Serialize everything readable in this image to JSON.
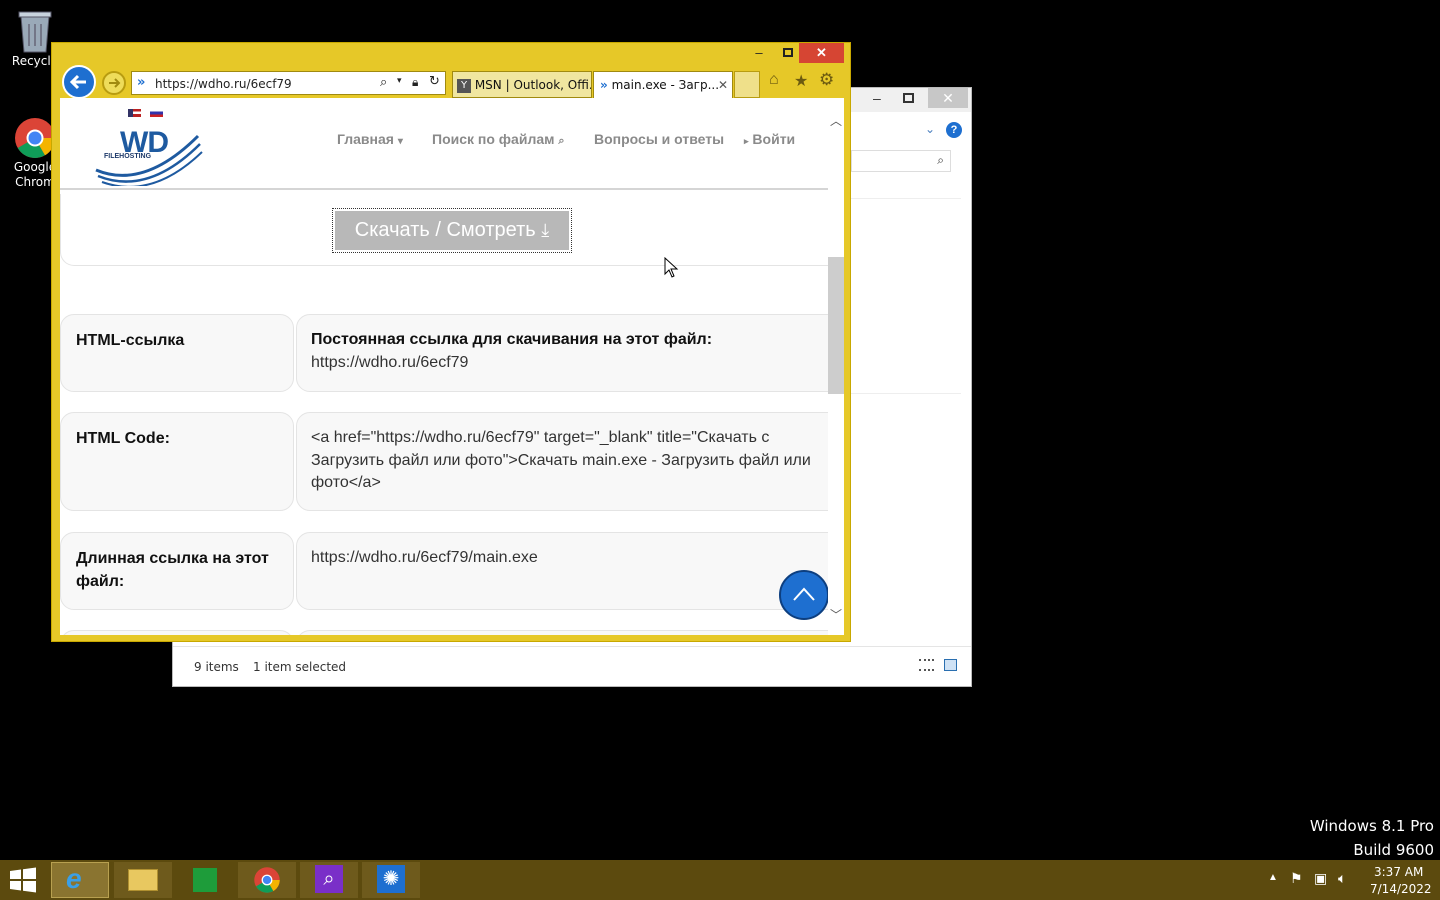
{
  "desktop": {
    "recycle_label": "Recycle",
    "chrome_label_1": "Google",
    "chrome_label_2": "Chrom",
    "watermark_1": "Windows 8.1 Pro",
    "watermark_2": "Build 9600"
  },
  "explorer": {
    "items_count": "9 items",
    "selection": "1 item selected"
  },
  "browser": {
    "address": "https://wdho.ru/6ecf79",
    "tabs": [
      {
        "label": "MSN | Outlook, Offi..."
      },
      {
        "label": "main.exe - Загр..."
      }
    ]
  },
  "site": {
    "logo_text": "WD",
    "logo_sub": "FILEHOSTING",
    "nav": {
      "home": "Главная",
      "search": "Поиск по файлам",
      "faq": "Вопросы и ответы",
      "login": "Войти"
    },
    "download_button": "Скачать / Смотреть",
    "rows": [
      {
        "label": "HTML-ссылка",
        "value_bold": "Постоянная ссылка для скачивания на этот файл:",
        "value": "https://wdho.ru/6ecf79"
      },
      {
        "label": "HTML Code:",
        "value_line1": "<a href=\"https://wdho.ru/6ecf79\" target=\"_blank\" title=\"Скачать с",
        "value_line2": "Загрузить файл или фото\">Скачать main.exe - Загрузить файл или",
        "value_line3": "фото</a>"
      },
      {
        "label_line1": "Длинная ссылка на этот",
        "label_line2": "файл:",
        "value": "https://wdho.ru/6ecf79/main.exe"
      }
    ]
  },
  "taskbar": {
    "time": "3:37 AM",
    "date": "7/14/2022"
  },
  "colors": {
    "ie_frame": "#e6c828",
    "taskbar": "#5c4a0e",
    "back_button": "#1e6fd0",
    "close_red": "#d64533"
  }
}
